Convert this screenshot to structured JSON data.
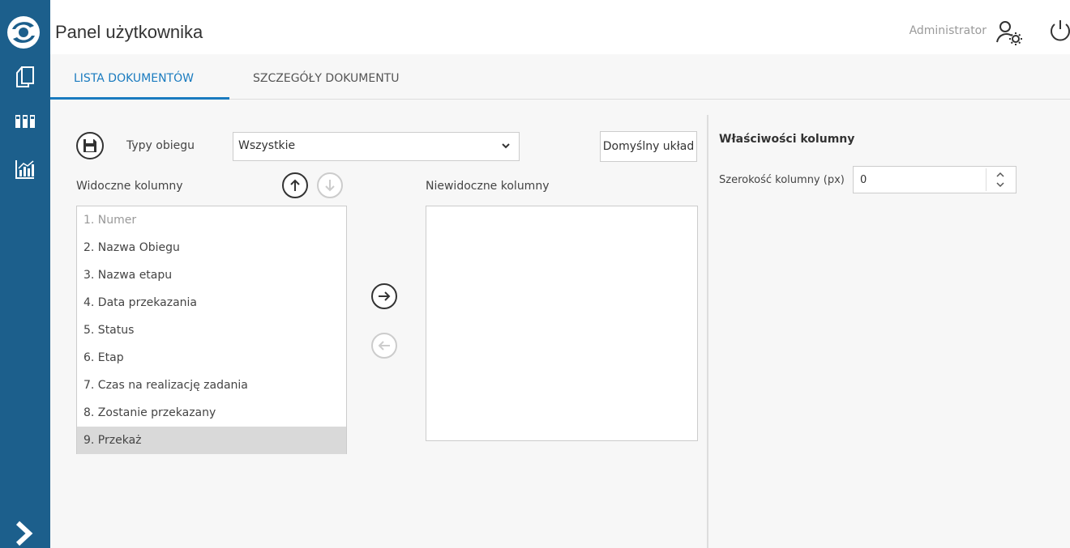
{
  "header": {
    "app_title": "Panel użytkownika",
    "user_name": "Administrator"
  },
  "tabs": [
    {
      "label": "LISTA DOKUMENTÓW",
      "active": true
    },
    {
      "label": "SZCZEGÓŁY DOKUMENTU",
      "active": false
    }
  ],
  "toolbar": {
    "types_label": "Typy obiegu",
    "types_selected": "Wszystkie",
    "default_layout_label": "Domyślny układ"
  },
  "columns": {
    "visible_label": "Widoczne kolumny",
    "hidden_label": "Niewidoczne kolumny",
    "visible_items": [
      {
        "label": "1. Numer",
        "state": "disabled"
      },
      {
        "label": "2. Nazwa Obiegu",
        "state": "normal"
      },
      {
        "label": "3. Nazwa etapu",
        "state": "normal"
      },
      {
        "label": "4. Data przekazania",
        "state": "normal"
      },
      {
        "label": "5. Status",
        "state": "normal"
      },
      {
        "label": "6. Etap",
        "state": "normal"
      },
      {
        "label": "7. Czas na realizację zadania",
        "state": "normal"
      },
      {
        "label": "8. Zostanie przekazany",
        "state": "normal"
      },
      {
        "label": "9. Przekaż",
        "state": "selected"
      }
    ],
    "hidden_items": []
  },
  "properties": {
    "title": "Właściwości kolumny",
    "width_label": "Szerokość kolumny (px)",
    "width_value": "0"
  },
  "colors": {
    "sidebar": "#1c5f8c",
    "accent": "#1a7bbf",
    "selected_row": "#d9d9d9"
  },
  "icons": {
    "sidebar": [
      "documents-icon",
      "columns-icon",
      "chart-icon"
    ],
    "header": [
      "user-settings-icon",
      "power-icon"
    ]
  }
}
